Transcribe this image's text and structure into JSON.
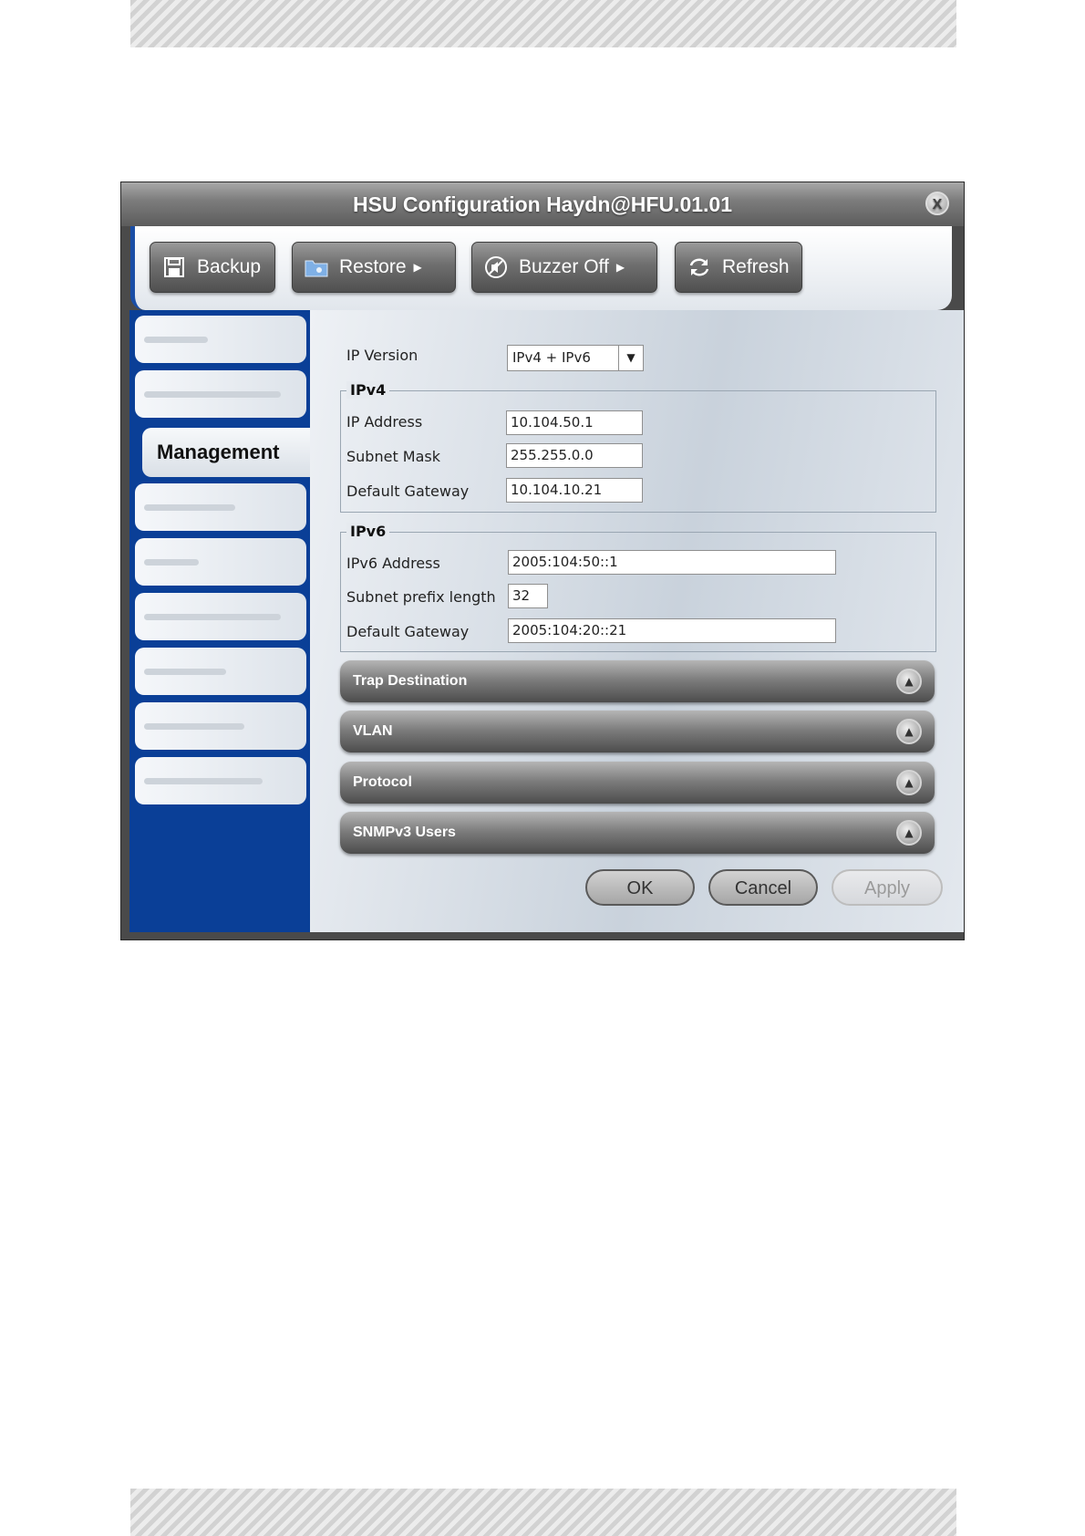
{
  "window": {
    "title": "HSU Configuration Haydn@HFU.01.01",
    "close_label": "X"
  },
  "toolbar": {
    "backup_label": "Backup",
    "restore_label": "Restore",
    "buzzer_label": "Buzzer Off",
    "refresh_label": "Refresh"
  },
  "sidebar": {
    "active_tab": "Management"
  },
  "form": {
    "ip_version": {
      "label": "IP Version",
      "value": "IPv4 + IPv6"
    },
    "ipv4": {
      "title": "IPv4",
      "ip_address": {
        "label": "IP Address",
        "value": "10.104.50.1"
      },
      "subnet_mask": {
        "label": "Subnet Mask",
        "value": "255.255.0.0"
      },
      "gateway": {
        "label": "Default Gateway",
        "value": "10.104.10.21"
      }
    },
    "ipv6": {
      "title": "IPv6",
      "address": {
        "label": "IPv6 Address",
        "value": "2005:104:50::1"
      },
      "prefix": {
        "label": "Subnet prefix length",
        "value": "32"
      },
      "gateway": {
        "label": "Default Gateway",
        "value": "2005:104:20::21"
      }
    }
  },
  "sections": [
    {
      "label": "Trap Destination"
    },
    {
      "label": "VLAN"
    },
    {
      "label": "Protocol"
    },
    {
      "label": "SNMPv3 Users"
    }
  ],
  "buttons": {
    "ok": "OK",
    "cancel": "Cancel",
    "apply": "Apply"
  }
}
